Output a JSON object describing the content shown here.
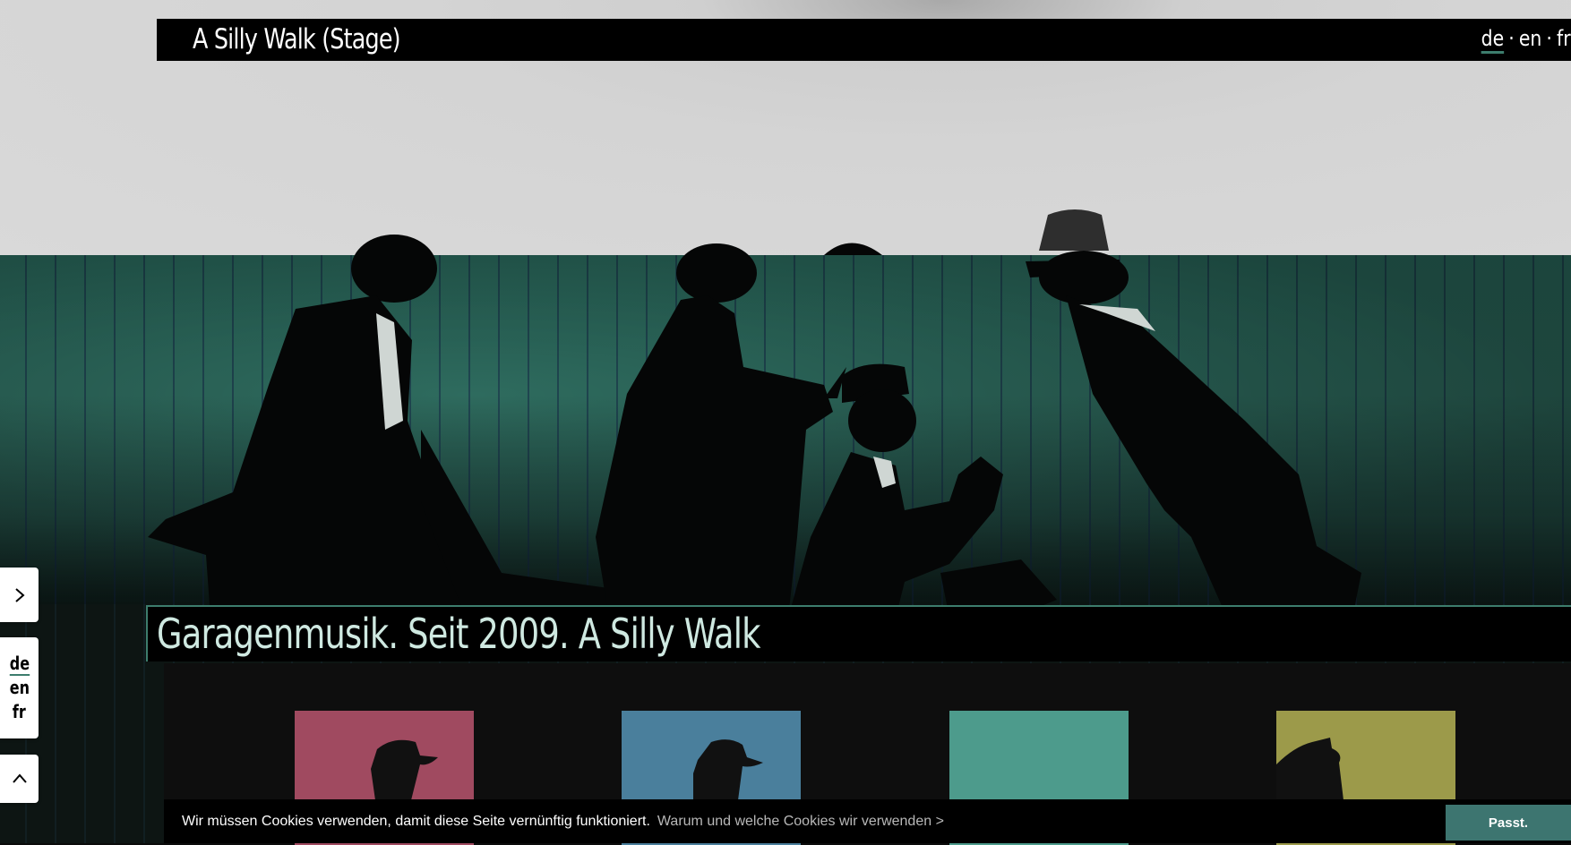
{
  "header": {
    "site_title": "A Silly Walk (Stage)",
    "languages": [
      "de",
      "en",
      "fr"
    ],
    "language_separator": "·",
    "active_language": "de"
  },
  "tagline": "Garagenmusik. Seit 2009. A Silly Walk",
  "side_nav": {
    "expand_icon": "chevron-right-icon",
    "languages": [
      "de",
      "en",
      "fr"
    ],
    "scroll_top_icon": "chevron-up-icon"
  },
  "tiles": [
    {
      "color": "#a04a60",
      "image": "hat-silhouette"
    },
    {
      "color": "#4a7f9c",
      "image": "hat-silhouette"
    },
    {
      "color": "#4d9b8c",
      "image": ""
    },
    {
      "color": "#9c9a4a",
      "image": "hat-silhouette"
    }
  ],
  "cookie": {
    "message": "Wir müssen Cookies verwenden, damit diese Seite vernünftig funktioniert.",
    "link": "Warum und welche Cookies wir verwenden >",
    "accept": "Passt."
  },
  "colors": {
    "accent": "#3d7d6d",
    "teal_wall": "#2e6b5e",
    "header_bg": "#000000"
  }
}
